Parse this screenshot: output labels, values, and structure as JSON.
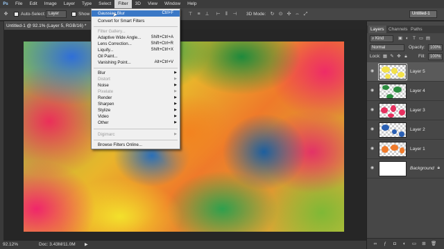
{
  "menubar": {
    "logo": "Ps",
    "items": [
      "File",
      "Edit",
      "Image",
      "Layer",
      "Type",
      "Select",
      "Filter",
      "3D",
      "View",
      "Window",
      "Help"
    ]
  },
  "options": {
    "auto_select_label": "Auto-Select:",
    "auto_select_value": "Layer",
    "show_label": "Show",
    "mode_label": "3D Mode:",
    "workspace": "Untitled-1"
  },
  "document": {
    "tab_title": "Untitled-1 @ 92.1% (Layer 5, RGB/16) *"
  },
  "filter_menu": {
    "items": [
      {
        "label": "Gaussian Blur",
        "shortcut": "Ctrl+F",
        "state": "highlighted",
        "submenu": false
      },
      {
        "label": "Convert for Smart Filters",
        "shortcut": "",
        "state": "normal",
        "submenu": false
      },
      {
        "label": "Filter Gallery...",
        "shortcut": "",
        "state": "disabled",
        "submenu": false
      },
      {
        "label": "Adaptive Wide Angle...",
        "shortcut": "Shift+Ctrl+A",
        "state": "normal",
        "submenu": false
      },
      {
        "label": "Lens Correction...",
        "shortcut": "Shift+Ctrl+R",
        "state": "normal",
        "submenu": false
      },
      {
        "label": "Liquify...",
        "shortcut": "Shift+Ctrl+X",
        "state": "normal",
        "submenu": false
      },
      {
        "label": "Oil Paint...",
        "shortcut": "",
        "state": "normal",
        "submenu": false
      },
      {
        "label": "Vanishing Point...",
        "shortcut": "Alt+Ctrl+V",
        "state": "normal",
        "submenu": false
      },
      {
        "label": "Blur",
        "shortcut": "",
        "state": "normal",
        "submenu": true
      },
      {
        "label": "Distort",
        "shortcut": "",
        "state": "disabled",
        "submenu": true
      },
      {
        "label": "Noise",
        "shortcut": "",
        "state": "normal",
        "submenu": true
      },
      {
        "label": "Pixelate",
        "shortcut": "",
        "state": "disabled",
        "submenu": true
      },
      {
        "label": "Render",
        "shortcut": "",
        "state": "normal",
        "submenu": true
      },
      {
        "label": "Sharpen",
        "shortcut": "",
        "state": "normal",
        "submenu": true
      },
      {
        "label": "Stylize",
        "shortcut": "",
        "state": "normal",
        "submenu": true
      },
      {
        "label": "Video",
        "shortcut": "",
        "state": "normal",
        "submenu": true
      },
      {
        "label": "Other",
        "shortcut": "",
        "state": "normal",
        "submenu": true
      },
      {
        "label": "Digimarc",
        "shortcut": "",
        "state": "disabled",
        "submenu": true
      },
      {
        "label": "Browse Filters Online...",
        "shortcut": "",
        "state": "normal",
        "submenu": false
      }
    ]
  },
  "panel": {
    "tabs": [
      "Layers",
      "Channels",
      "Paths"
    ],
    "kind_label": "Kind",
    "blend_mode": "Normal",
    "opacity_label": "Opacity:",
    "opacity_value": "100%",
    "lock_label": "Lock:",
    "fill_label": "Fill:",
    "fill_value": "100%",
    "layers": [
      {
        "name": "Layer 5",
        "selected": true
      },
      {
        "name": "Layer 4",
        "selected": false
      },
      {
        "name": "Layer 3",
        "selected": false
      },
      {
        "name": "Layer 2",
        "selected": false
      },
      {
        "name": "Layer 1",
        "selected": false
      },
      {
        "name": "Background",
        "selected": false
      }
    ]
  },
  "status": {
    "zoom": "92.12%",
    "doc_info": "Doc: 3.43M/11.0M"
  },
  "colors": {
    "menu_highlight": "#3a78c6",
    "panel_bg": "#474747",
    "canvas_bg": "#262626"
  }
}
